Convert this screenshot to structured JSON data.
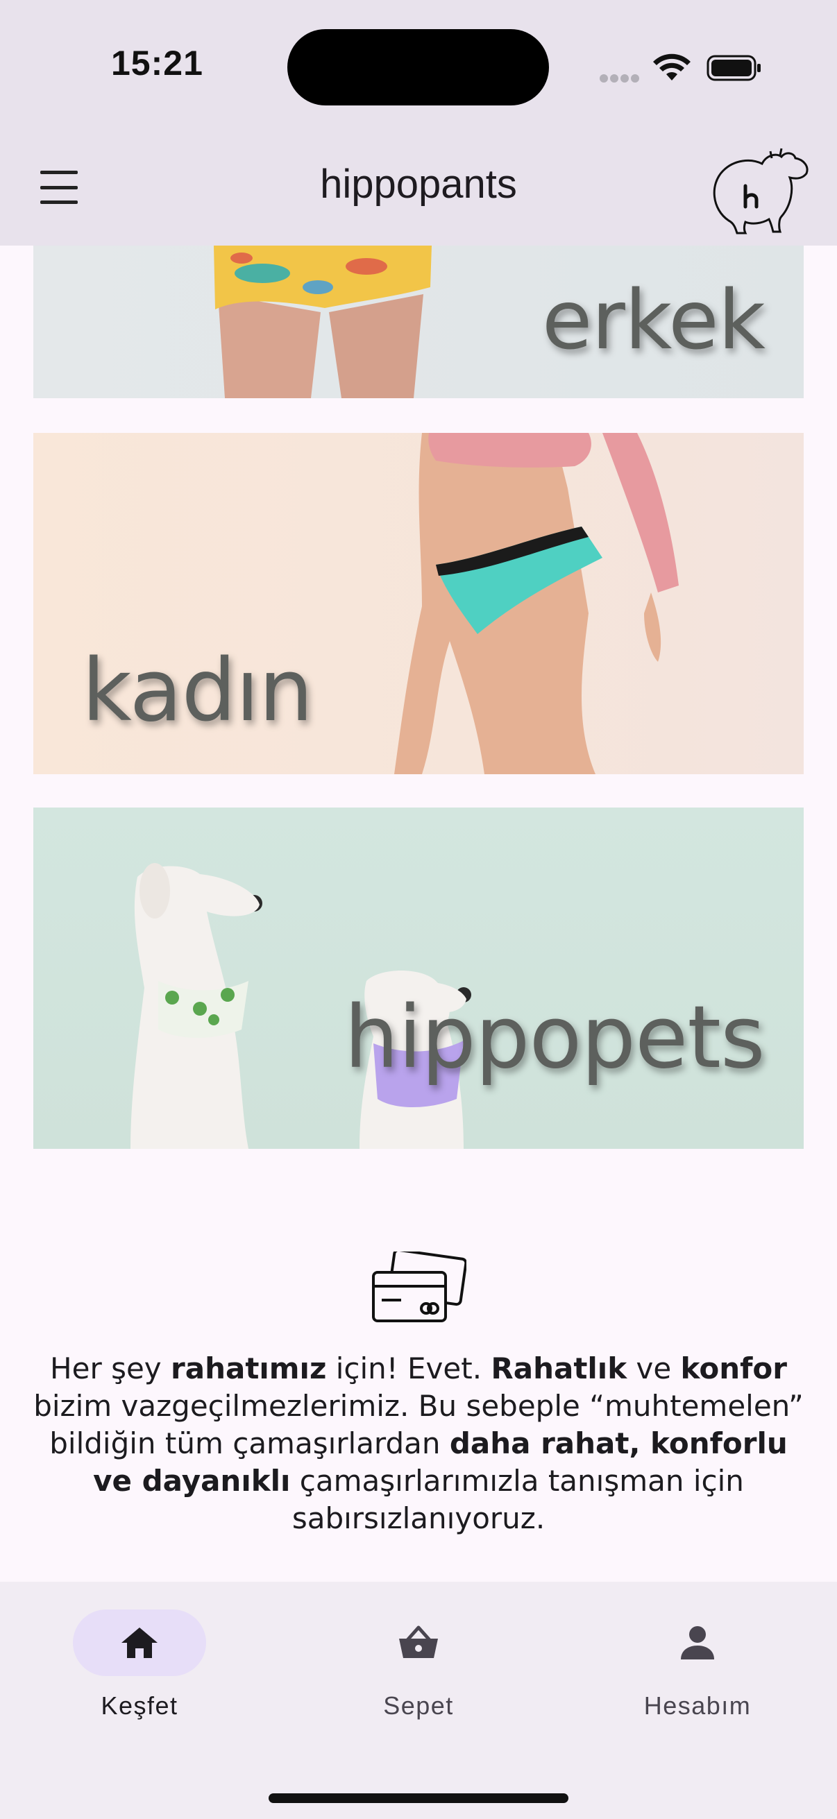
{
  "status_bar": {
    "time": "15:21"
  },
  "header": {
    "title": "hippopants",
    "menu_icon": "hamburger-menu-icon",
    "logo_icon": "hippo-logo-icon"
  },
  "banners": [
    {
      "label": "erkek"
    },
    {
      "label": "kadın"
    },
    {
      "label": "hippopets"
    }
  ],
  "info": {
    "icon": "credit-cards-icon",
    "parts": [
      {
        "text": "Her şey ",
        "bold": false
      },
      {
        "text": "rahatımız",
        "bold": true
      },
      {
        "text": " için! Evet. ",
        "bold": false
      },
      {
        "text": "Rahatlık",
        "bold": true
      },
      {
        "text": " ve ",
        "bold": false
      },
      {
        "text": "konfor",
        "bold": true
      },
      {
        "text": " bizim vazgeçilmezlerimiz. Bu sebeple “muhtemelen” bildiğin tüm çamaşırlardan ",
        "bold": false
      },
      {
        "text": "daha rahat, konforlu ve dayanıklı",
        "bold": true
      },
      {
        "text": " çamaşırlarımızla tanışman için sabırsızlanıyoruz.",
        "bold": false
      }
    ]
  },
  "bottom_nav": {
    "items": [
      {
        "label": "Keşfet",
        "icon": "home-icon",
        "active": true
      },
      {
        "label": "Sepet",
        "icon": "basket-icon",
        "active": false
      },
      {
        "label": "Hesabım",
        "icon": "person-icon",
        "active": false
      }
    ]
  },
  "colors": {
    "header_bg": "#e8e2ec",
    "page_bg": "#fdf7fd",
    "nav_bg": "#f1ecf3",
    "active_pill": "#e7def8",
    "banner_label": "#5d605d"
  }
}
